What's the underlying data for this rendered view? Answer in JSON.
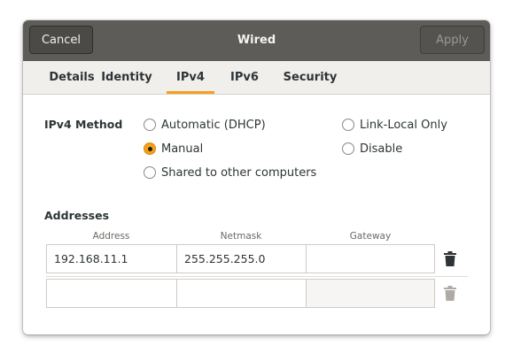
{
  "window": {
    "title": "Wired",
    "cancel_label": "Cancel",
    "apply_label": "Apply"
  },
  "tabs": [
    {
      "label": "Details"
    },
    {
      "label": "Identity"
    },
    {
      "label": "IPv4",
      "active": true
    },
    {
      "label": "IPv6"
    },
    {
      "label": "Security"
    }
  ],
  "ipv4": {
    "method_label": "IPv4 Method",
    "selected_method": "Manual",
    "methods": [
      {
        "label": "Automatic (DHCP)",
        "checked": false
      },
      {
        "label": "Manual",
        "checked": true
      },
      {
        "label": "Shared to other computers",
        "checked": false
      },
      {
        "label": "Link-Local Only",
        "checked": false
      },
      {
        "label": "Disable",
        "checked": false
      }
    ]
  },
  "addresses": {
    "label": "Addresses",
    "columns": [
      "Address",
      "Netmask",
      "Gateway"
    ],
    "rows": [
      {
        "address": "192.168.11.1",
        "netmask": "255.255.255.0",
        "gateway": ""
      },
      {
        "address": "",
        "netmask": "",
        "gateway": ""
      }
    ]
  },
  "colors": {
    "accent": "#f6a01a",
    "headerbar": "#5e5c58"
  },
  "icons": {
    "delete": "trash-icon"
  }
}
